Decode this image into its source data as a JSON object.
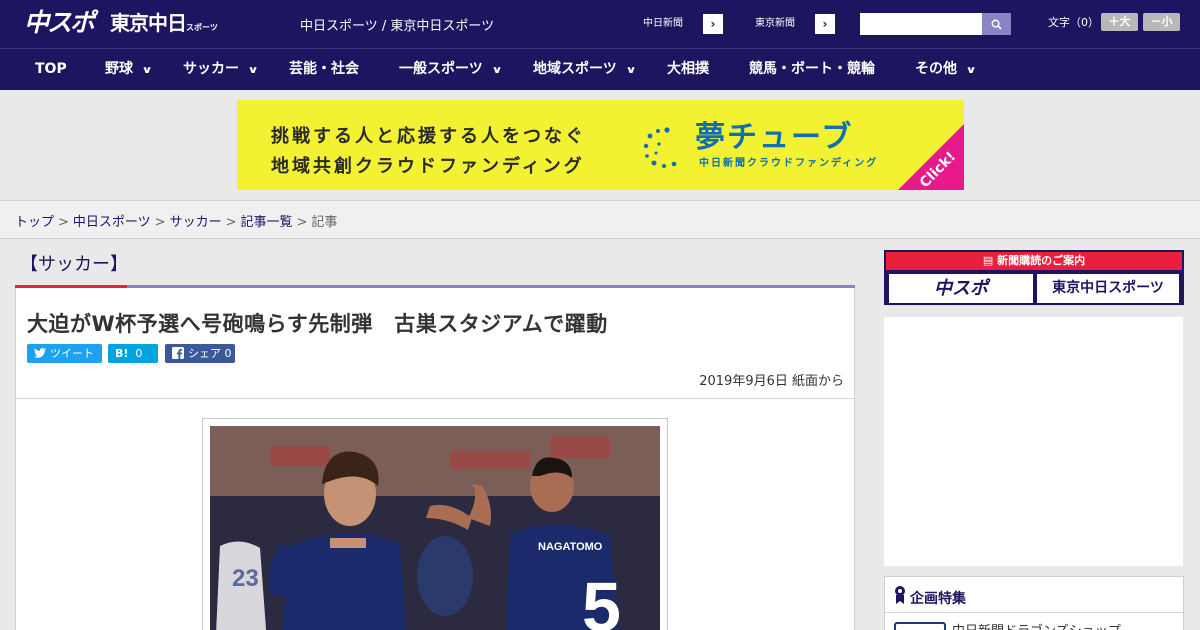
{
  "header": {
    "logo_main": "中スポ",
    "logo_tokyo": "東京中日",
    "logo_tokyo_sub": "スポーツ",
    "tagline": "中日スポーツ / 東京中日スポーツ",
    "paper_links": [
      {
        "label": "中日新聞"
      },
      {
        "label": "東京新聞"
      }
    ],
    "search": {
      "placeholder": "",
      "value": ""
    },
    "font_size_label": "文字（0）",
    "font_larger": "＋大",
    "font_smaller": "－小"
  },
  "nav": {
    "items": [
      {
        "label": "TOP",
        "has_menu": false
      },
      {
        "label": "野球",
        "has_menu": true
      },
      {
        "label": "サッカー",
        "has_menu": true
      },
      {
        "label": "芸能・社会",
        "has_menu": false
      },
      {
        "label": "一般スポーツ",
        "has_menu": true
      },
      {
        "label": "地域スポーツ",
        "has_menu": true
      },
      {
        "label": "大相撲",
        "has_menu": false
      },
      {
        "label": "競馬・ボート・競輪",
        "has_menu": false
      },
      {
        "label": "その他",
        "has_menu": true
      }
    ]
  },
  "banner": {
    "line1": "挑戦する人と応援する人をつなぐ",
    "line2": "地域共創クラウドファンディング",
    "brand": "夢チューブ",
    "brand_sub": "中日新聞クラウドファンディング",
    "click": "Click!",
    "colors": {
      "background": "#f2f233",
      "brand": "#0f6fb0",
      "corner": "#e8198b"
    }
  },
  "breadcrumb": {
    "links": [
      "トップ",
      "中日スポーツ",
      "サッカー",
      "記事一覧"
    ],
    "current": "記事"
  },
  "article": {
    "section": "【サッカー】",
    "title": "大迫がW杯予選へ号砲鳴らす先制弾　古巣スタジアムで躍動",
    "share": {
      "tweet_label": "ツイート",
      "hatena_label": "B!",
      "hatena_count": "0",
      "facebook_label": "シェア",
      "facebook_count": "0"
    },
    "date": "2019年9月6日 紙面から",
    "photo": {
      "jersey_name": "NAGATOMO",
      "jersey_number": "5",
      "other_number": "23"
    }
  },
  "sidebar": {
    "subscribe_head": "新聞購読のご案内",
    "subscribe_logos": [
      "中スポ",
      "東京中日スポーツ"
    ],
    "feature_title": "企画特集",
    "feature_item": "中日新聞ドラゴンズショップ"
  },
  "colors": {
    "brand_navy": "#1e1560",
    "accent_red": "#e8203c",
    "accent_purple": "#8a84c6"
  }
}
